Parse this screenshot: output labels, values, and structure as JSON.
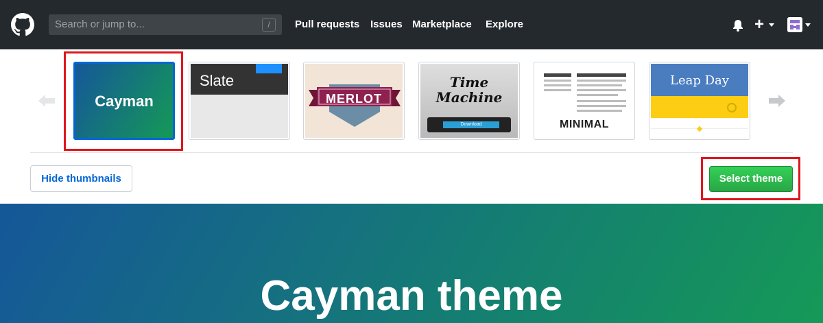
{
  "header": {
    "search": {
      "placeholder": "Search or jump to...",
      "shortcut": "/"
    },
    "nav": [
      "Pull requests",
      "Issues",
      "Marketplace",
      "Explore"
    ],
    "icons": [
      "github-logo-icon",
      "bell-icon",
      "plus-icon",
      "avatar"
    ]
  },
  "themes": [
    {
      "id": "cayman",
      "label": "Cayman",
      "selected": true
    },
    {
      "id": "slate",
      "label": "Slate",
      "selected": false
    },
    {
      "id": "merlot",
      "label": "MERLOT",
      "selected": false
    },
    {
      "id": "time-machine",
      "label": "Time Machine",
      "sub": "Download",
      "selected": false
    },
    {
      "id": "minimal",
      "label": "MINIMAL",
      "selected": false
    },
    {
      "id": "leap-day",
      "label": "Leap Day",
      "selected": false
    }
  ],
  "buttons": {
    "hide_thumbnails": "Hide thumbnails",
    "select_theme": "Select theme"
  },
  "preview": {
    "title": "Cayman theme"
  },
  "colors": {
    "header_bg": "#24292e",
    "selected_border": "#0366d6",
    "highlight": "#e0161d",
    "gradient_start": "#155799",
    "gradient_end": "#159957",
    "select_btn": "#28a745"
  }
}
